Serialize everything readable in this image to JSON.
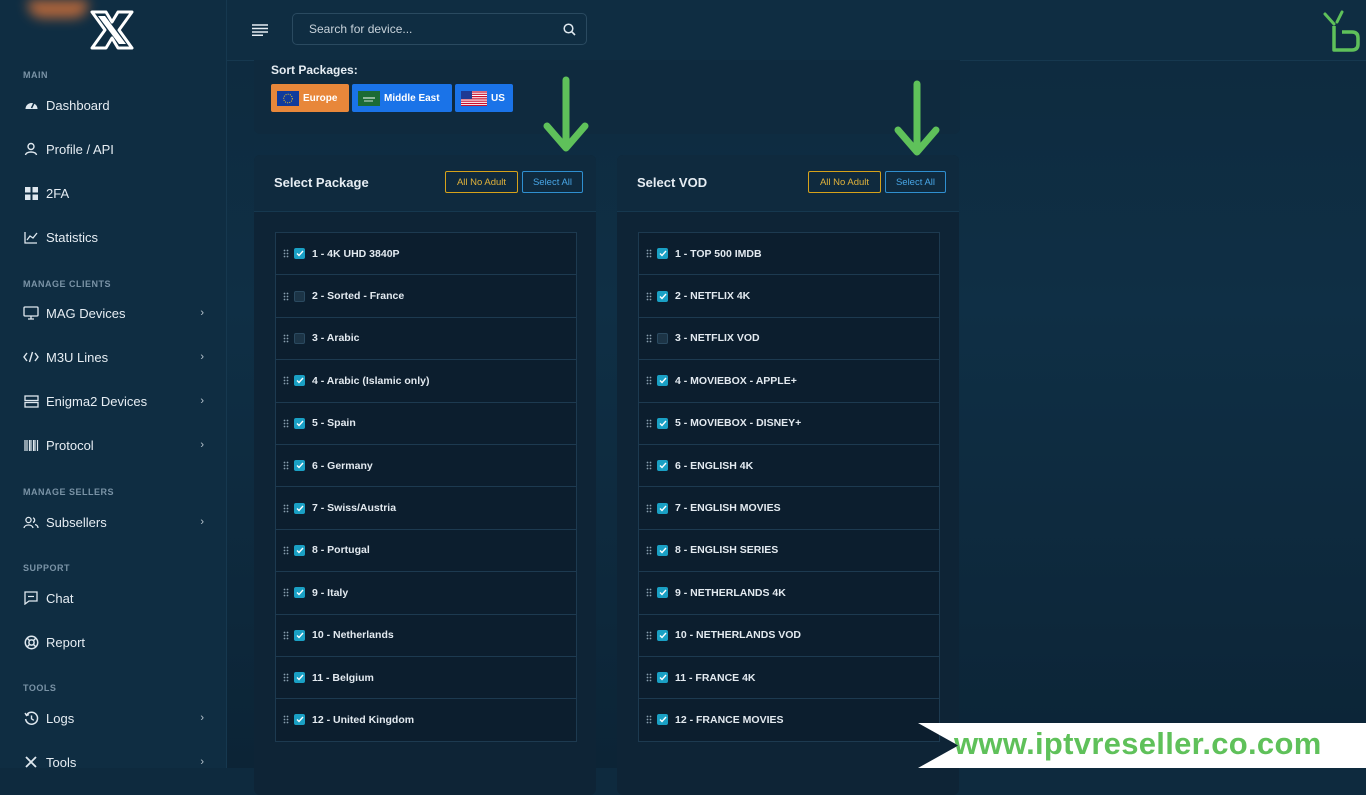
{
  "sidebar": {
    "sections": [
      {
        "label": "MAIN"
      },
      {
        "label": "MANAGE CLIENTS"
      },
      {
        "label": "MANAGE SELLERS"
      },
      {
        "label": "SUPPORT"
      },
      {
        "label": "TOOLS"
      }
    ],
    "items": [
      {
        "label": "Dashboard",
        "icon": "dashboard-icon"
      },
      {
        "label": "Profile / API",
        "icon": "user-icon"
      },
      {
        "label": "2FA",
        "icon": "grid-icon"
      },
      {
        "label": "Statistics",
        "icon": "chart-line-icon"
      },
      {
        "label": "MAG Devices",
        "icon": "monitor-icon"
      },
      {
        "label": "M3U Lines",
        "icon": "code-icon"
      },
      {
        "label": "Enigma2 Devices",
        "icon": "server-icon"
      },
      {
        "label": "Protocol",
        "icon": "barcode-icon"
      },
      {
        "label": "Subsellers",
        "icon": "users-icon"
      },
      {
        "label": "Chat",
        "icon": "message-icon"
      },
      {
        "label": "Report",
        "icon": "lifebuoy-icon"
      },
      {
        "label": "Logs",
        "icon": "history-icon"
      },
      {
        "label": "Tools",
        "icon": "tools-icon"
      }
    ]
  },
  "topbar": {
    "search_placeholder": "Search for device..."
  },
  "sort": {
    "title": "Sort Packages:",
    "buttons": [
      {
        "label": "Europe",
        "color": "#e8873a"
      },
      {
        "label": "Middle East",
        "color": "#1a73e8"
      },
      {
        "label": "US",
        "color": "#1a73e8"
      }
    ]
  },
  "packages": {
    "title": "Select Package",
    "no_adult_label": "All No Adult",
    "select_all_label": "Select All",
    "items": [
      {
        "label": "1 - 4K UHD 3840P",
        "checked": true
      },
      {
        "label": "2 - Sorted - France",
        "checked": false
      },
      {
        "label": "3 - Arabic",
        "checked": false
      },
      {
        "label": "4 - Arabic (Islamic only)",
        "checked": true
      },
      {
        "label": "5 - Spain",
        "checked": true
      },
      {
        "label": "6 - Germany",
        "checked": true
      },
      {
        "label": "7 - Swiss/Austria",
        "checked": true
      },
      {
        "label": "8 - Portugal",
        "checked": true
      },
      {
        "label": "9 - Italy",
        "checked": true
      },
      {
        "label": "10 - Netherlands",
        "checked": true
      },
      {
        "label": "11 - Belgium",
        "checked": true
      },
      {
        "label": "12 - United Kingdom",
        "checked": true
      }
    ]
  },
  "vod": {
    "title": "Select VOD",
    "no_adult_label": "All No Adult",
    "select_all_label": "Select All",
    "items": [
      {
        "label": "1 - TOP 500 IMDB",
        "checked": true
      },
      {
        "label": "2 - NETFLIX 4K",
        "checked": true
      },
      {
        "label": "3 - NETFLIX VOD",
        "checked": false
      },
      {
        "label": "4 - MOVIEBOX - APPLE+",
        "checked": true
      },
      {
        "label": "5 - MOVIEBOX - DISNEY+",
        "checked": true
      },
      {
        "label": "6 - ENGLISH 4K",
        "checked": true
      },
      {
        "label": "7 - ENGLISH MOVIES",
        "checked": true
      },
      {
        "label": "8 - ENGLISH SERIES",
        "checked": true
      },
      {
        "label": "9 - NETHERLANDS 4K",
        "checked": true
      },
      {
        "label": "10 - NETHERLANDS VOD",
        "checked": true
      },
      {
        "label": "11 - FRANCE 4K",
        "checked": true
      },
      {
        "label": "12 - FRANCE MOVIES",
        "checked": true
      }
    ]
  },
  "watermark": {
    "text": "www.iptvreseller.co.com"
  },
  "colors": {
    "accent_green": "#5fc15a",
    "checkbox": "#1aa0c4",
    "warning": "#d6a21a",
    "info": "#2f8fd0"
  }
}
